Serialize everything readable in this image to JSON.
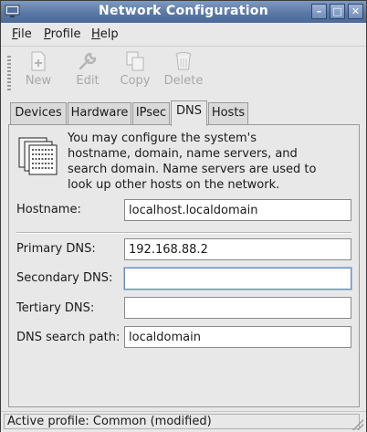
{
  "window": {
    "title": "Network Configuration",
    "controls": [
      "minimize-icon",
      "maximize-icon",
      "close-icon"
    ]
  },
  "menubar": {
    "items": [
      {
        "label": "File",
        "mnemonic": "F"
      },
      {
        "label": "Profile",
        "mnemonic": "P"
      },
      {
        "label": "Help",
        "mnemonic": "H"
      }
    ]
  },
  "toolbar": {
    "buttons": [
      {
        "label": "New",
        "icon": "new-icon",
        "enabled": false
      },
      {
        "label": "Edit",
        "icon": "wrench-icon",
        "enabled": false
      },
      {
        "label": "Copy",
        "icon": "copy-icon",
        "enabled": false
      },
      {
        "label": "Delete",
        "icon": "trash-icon",
        "enabled": false
      }
    ]
  },
  "tabs": [
    {
      "label": "Devices",
      "active": false
    },
    {
      "label": "Hardware",
      "active": false
    },
    {
      "label": "IPsec",
      "active": false
    },
    {
      "label": "DNS",
      "active": true
    },
    {
      "label": "Hosts",
      "active": false
    }
  ],
  "dns": {
    "icon": "dns-server-icon",
    "description_lines": [
      "You may configure the system's",
      "hostname, domain, name servers, and",
      "search domain. Name servers are used to",
      "look up other hosts on the network."
    ],
    "hostname_label": "Hostname:",
    "hostname_value": "localhost.localdomain",
    "primary_label": "Primary DNS:",
    "primary_value": "192.168.88.2",
    "secondary_label": "Secondary DNS:",
    "secondary_value": "",
    "tertiary_label": "Tertiary DNS:",
    "tertiary_value": "",
    "search_label": "DNS search path:",
    "search_value": "localdomain"
  },
  "statusbar": {
    "text": "Active profile: Common (modified)"
  },
  "colors": {
    "titlebar": "#5a78a6",
    "window_bg": "#e8e8e8",
    "focus_border": "#6d8bbf"
  }
}
